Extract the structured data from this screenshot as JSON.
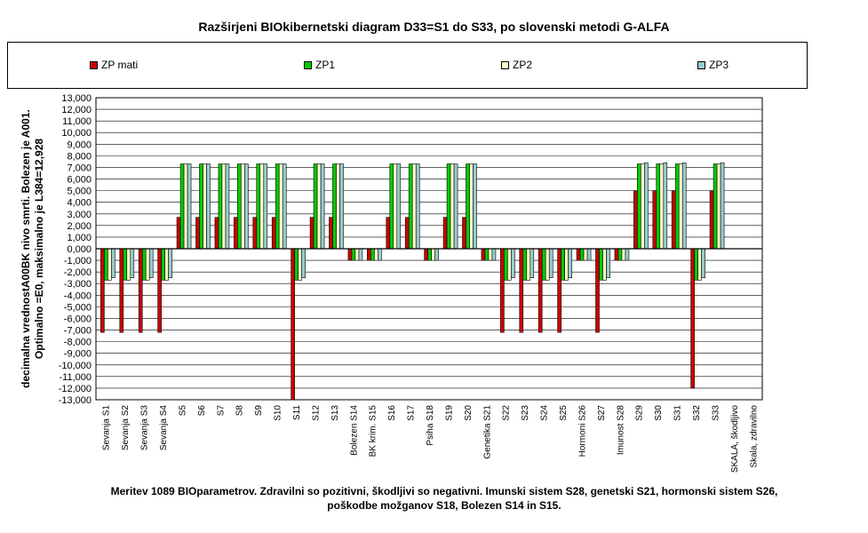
{
  "chart_data": {
    "type": "bar",
    "title": "Razširjeni BIOkibernetski diagram  D33=S1 do S33, po slovenski metodi G-ALFA",
    "ylabel": "decimalna vrednostA00BK nivo smrti. Bolezen je A001. Optimalno =E0, maksimalno je L384=12,928",
    "caption": "Meritev 1089 BIOparametrov. Zdravilni so pozitivni, škodljivi so negativni. Imunski sistem S28, genetski S21, hormonski sistem S26, poškodbe možganov S18, Bolezen S14 in S15.",
    "ylim": [
      -13000,
      13000
    ],
    "ytick_step": 1000,
    "grid": true,
    "legend_position": "top",
    "categories": [
      "Sevanja S1",
      "Sevanja S2",
      "Sevanja S3",
      "Sevanja S4",
      "S5",
      "S6",
      "S7",
      "S8",
      "S9",
      "S10",
      "S11",
      "S12",
      "S13",
      "Bolezen S14",
      "BK krim. S15",
      "S16",
      "S17",
      "Psiha S18",
      "S19",
      "S20",
      "Genetika S21",
      "S22",
      "S23",
      "S24",
      "S25",
      "Hormoni S26",
      "S27",
      "Imunost S28",
      "S29",
      "S30",
      "S31",
      "S32",
      "S33",
      "SKALA, škodljivo",
      "Skala, zdravilno"
    ],
    "series": [
      {
        "name": "ZP mati",
        "color": "#cc0000",
        "values": [
          -7200,
          -7200,
          -7200,
          -7200,
          2700,
          2700,
          2700,
          2700,
          2700,
          2700,
          -13000,
          2700,
          2700,
          -1000,
          -1000,
          2700,
          2700,
          -1000,
          2700,
          2700,
          -1000,
          -7200,
          -7200,
          -7200,
          -7200,
          -1000,
          -7200,
          -1000,
          5000,
          5000,
          5000,
          -12000,
          5000,
          0,
          0
        ]
      },
      {
        "name": "ZP1",
        "color": "#00cc00",
        "values": [
          -2700,
          -2700,
          -2700,
          -2700,
          7300,
          7300,
          7300,
          7300,
          7300,
          7300,
          -2700,
          7300,
          7300,
          -1000,
          -1000,
          7300,
          7300,
          -1000,
          7300,
          7300,
          -1000,
          -2700,
          -2700,
          -2700,
          -2700,
          -1000,
          -2700,
          -1000,
          7300,
          7300,
          7300,
          -2700,
          7300,
          0,
          0
        ]
      },
      {
        "name": "ZP2",
        "color": "#ffffcc",
        "values": [
          -2700,
          -2700,
          -2700,
          -2700,
          7300,
          7300,
          7300,
          7300,
          7300,
          7300,
          -2700,
          7300,
          7300,
          -1000,
          -1000,
          7300,
          7300,
          -1000,
          7300,
          7300,
          -1000,
          -2700,
          -2700,
          -2700,
          -2700,
          -1000,
          -2700,
          -1000,
          7300,
          7300,
          7300,
          -2700,
          7300,
          0,
          0
        ]
      },
      {
        "name": "ZP3",
        "color": "#99cccc",
        "values": [
          -2500,
          -2500,
          -2500,
          -2500,
          7300,
          7300,
          7300,
          7300,
          7300,
          7300,
          -2500,
          7300,
          7300,
          -1000,
          -1000,
          7300,
          7300,
          -1000,
          7300,
          7300,
          -1000,
          -2500,
          -2500,
          -2500,
          -2500,
          -1000,
          -2500,
          -1000,
          7400,
          7400,
          7400,
          -2500,
          7400,
          0,
          0
        ]
      }
    ]
  }
}
